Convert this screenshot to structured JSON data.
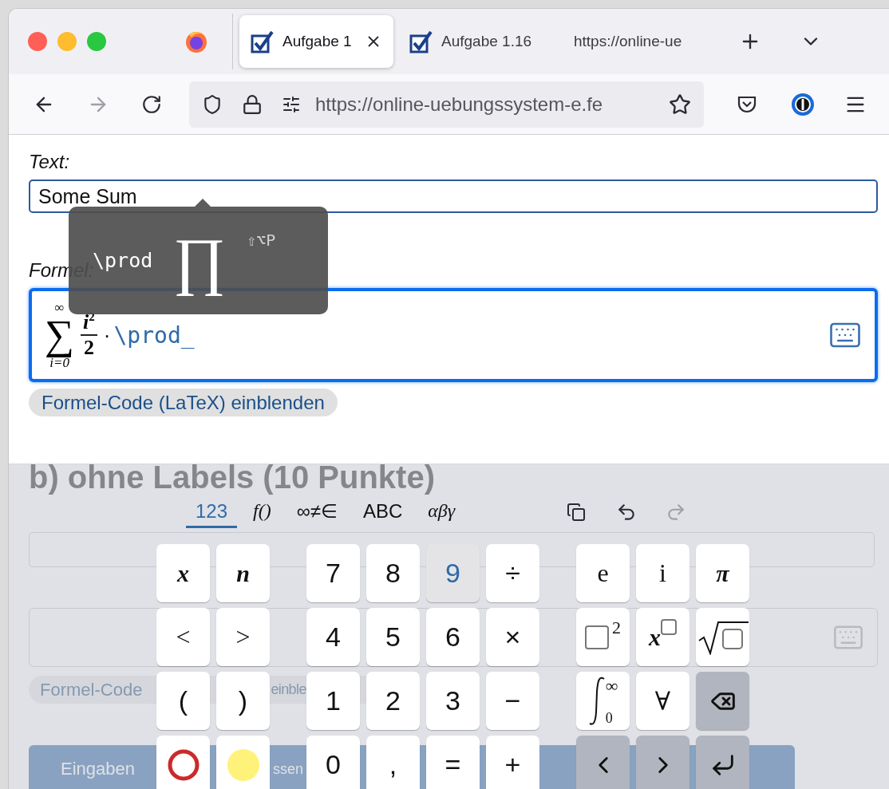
{
  "browser": {
    "tabs": [
      {
        "title": "Aufgabe 1",
        "selected": true,
        "favicon": true
      },
      {
        "title": "Aufgabe 1.16",
        "selected": false,
        "favicon": true
      },
      {
        "title": "https://online-ue",
        "selected": false,
        "favicon": false
      }
    ],
    "url": "https://online-uebungssystem-e.fe",
    "forward_disabled": true
  },
  "page": {
    "text_label": "Text:",
    "text_value": "Some Sum",
    "formula_label": "Formel:",
    "formula": {
      "sum_symbol": "∑",
      "sum_upper": "∞",
      "sum_lower": "i=0",
      "numerator": "i",
      "exponent": "2",
      "denominator": "2",
      "dot": "·",
      "command": "\\prod_"
    },
    "latex_toggle": "Formel-Code (LaTeX) einblenden",
    "section_heading": "b) ohne Labels (10 Punkte)",
    "latex_toggle_2": [
      "Formel-Code",
      "einble"
    ],
    "submit": [
      "Eingaben",
      "ssen"
    ]
  },
  "tooltip": {
    "command": "\\prod",
    "symbol": "∏",
    "shortcut": "⇧⌥P"
  },
  "keyboard": {
    "tabs": [
      {
        "label": "123",
        "selected": true,
        "kind": "sans"
      },
      {
        "label": "f()",
        "selected": false,
        "kind": "serif"
      },
      {
        "label": "∞≠∈",
        "selected": false,
        "kind": "sans"
      },
      {
        "label": "ABC",
        "selected": false,
        "kind": "sans"
      },
      {
        "label": "αβγ",
        "selected": false,
        "kind": "serif"
      }
    ],
    "redo_disabled": true,
    "groups": [
      {
        "keys": [
          {
            "kind": "var",
            "label": "x",
            "pressed": false
          },
          {
            "kind": "var",
            "label": "n",
            "pressed": false
          },
          {
            "kind": "serif",
            "label": "<",
            "pressed": false
          },
          {
            "kind": "serif",
            "label": ">",
            "pressed": false
          },
          {
            "kind": "num",
            "label": "(",
            "pressed": false
          },
          {
            "kind": "num",
            "label": ")",
            "pressed": false
          },
          {
            "kind": "ring",
            "color": "#cc2a2a",
            "pressed": false
          },
          {
            "kind": "dot",
            "color": "#fff27a",
            "pressed": false
          }
        ]
      },
      {
        "keys": [
          {
            "kind": "num",
            "label": "7",
            "pressed": false
          },
          {
            "kind": "num",
            "label": "8",
            "pressed": false
          },
          {
            "kind": "num",
            "label": "9",
            "pressed": true
          },
          {
            "kind": "num",
            "label": "÷",
            "pressed": false
          },
          {
            "kind": "num",
            "label": "4",
            "pressed": false
          },
          {
            "kind": "num",
            "label": "5",
            "pressed": false
          },
          {
            "kind": "num",
            "label": "6",
            "pressed": false
          },
          {
            "kind": "num",
            "label": "×",
            "pressed": false
          },
          {
            "kind": "num",
            "label": "1",
            "pressed": false
          },
          {
            "kind": "num",
            "label": "2",
            "pressed": false
          },
          {
            "kind": "num",
            "label": "3",
            "pressed": false
          },
          {
            "kind": "num",
            "label": "−",
            "pressed": false
          },
          {
            "kind": "num",
            "label": "0",
            "pressed": false
          },
          {
            "kind": "num",
            "label": ",",
            "pressed": false
          },
          {
            "kind": "num",
            "label": "=",
            "pressed": false
          },
          {
            "kind": "num",
            "label": "+",
            "pressed": false
          }
        ]
      },
      {
        "keys": [
          {
            "kind": "serif",
            "label": "e",
            "pressed": false
          },
          {
            "kind": "serif",
            "label": "i",
            "pressed": false
          },
          {
            "kind": "var",
            "label": "π",
            "pressed": false
          },
          {
            "kind": "square",
            "sup": "2",
            "pressed": false
          },
          {
            "kind": "power",
            "base": "x",
            "pressed": false
          },
          {
            "kind": "sqrt",
            "pressed": false
          },
          {
            "kind": "integral",
            "upper": "∞",
            "lower": "0",
            "pressed": false
          },
          {
            "kind": "serif",
            "label": "∀",
            "pressed": false
          },
          {
            "kind": "backspace",
            "pressed": false
          },
          {
            "kind": "left",
            "pressed": false
          },
          {
            "kind": "right",
            "pressed": false
          },
          {
            "kind": "enter",
            "pressed": false
          }
        ]
      }
    ]
  }
}
